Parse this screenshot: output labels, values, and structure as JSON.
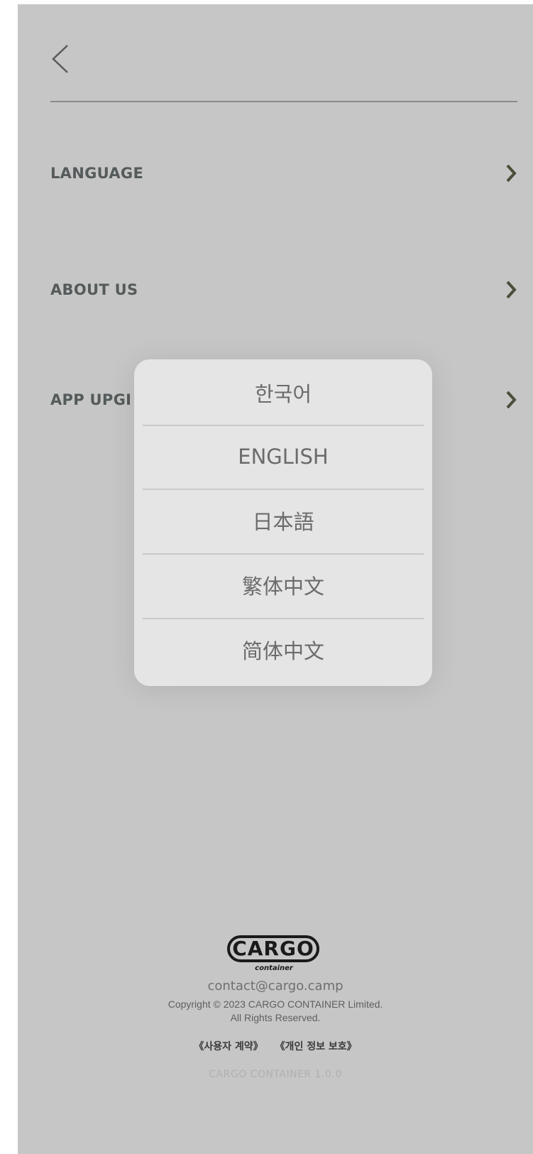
{
  "nav": {
    "back_icon": "chevron-left-icon"
  },
  "menu": {
    "items": [
      {
        "label": "LANGUAGE",
        "icon": "chevron-right-icon"
      },
      {
        "label": "ABOUT US",
        "icon": "chevron-right-icon"
      },
      {
        "label": "APP UPGI",
        "icon": "chevron-right-icon"
      }
    ]
  },
  "language_popup": {
    "options": [
      {
        "label": "한국어"
      },
      {
        "label": "ENGLISH"
      },
      {
        "label": "日本語"
      },
      {
        "label": "繁体中文"
      },
      {
        "label": "简体中文"
      }
    ]
  },
  "footer": {
    "logo_text": "CARGO",
    "logo_subtext": "container",
    "email": "contact@cargo.camp",
    "copyright_line1": "Copyright © 2023 CARGO CONTAINER Limited.",
    "copyright_line2": "All Rights Reserved.",
    "links": [
      {
        "label": "《사용자 계약》"
      },
      {
        "label": "《개인 정보 보호》"
      }
    ],
    "version": "CARGO CONTAINER 1.0.0"
  },
  "colors": {
    "background": "#c6c6c6",
    "popup": "#e5e5e6",
    "menu_text": "#555a5a",
    "chevron": "#4a4e3a"
  }
}
